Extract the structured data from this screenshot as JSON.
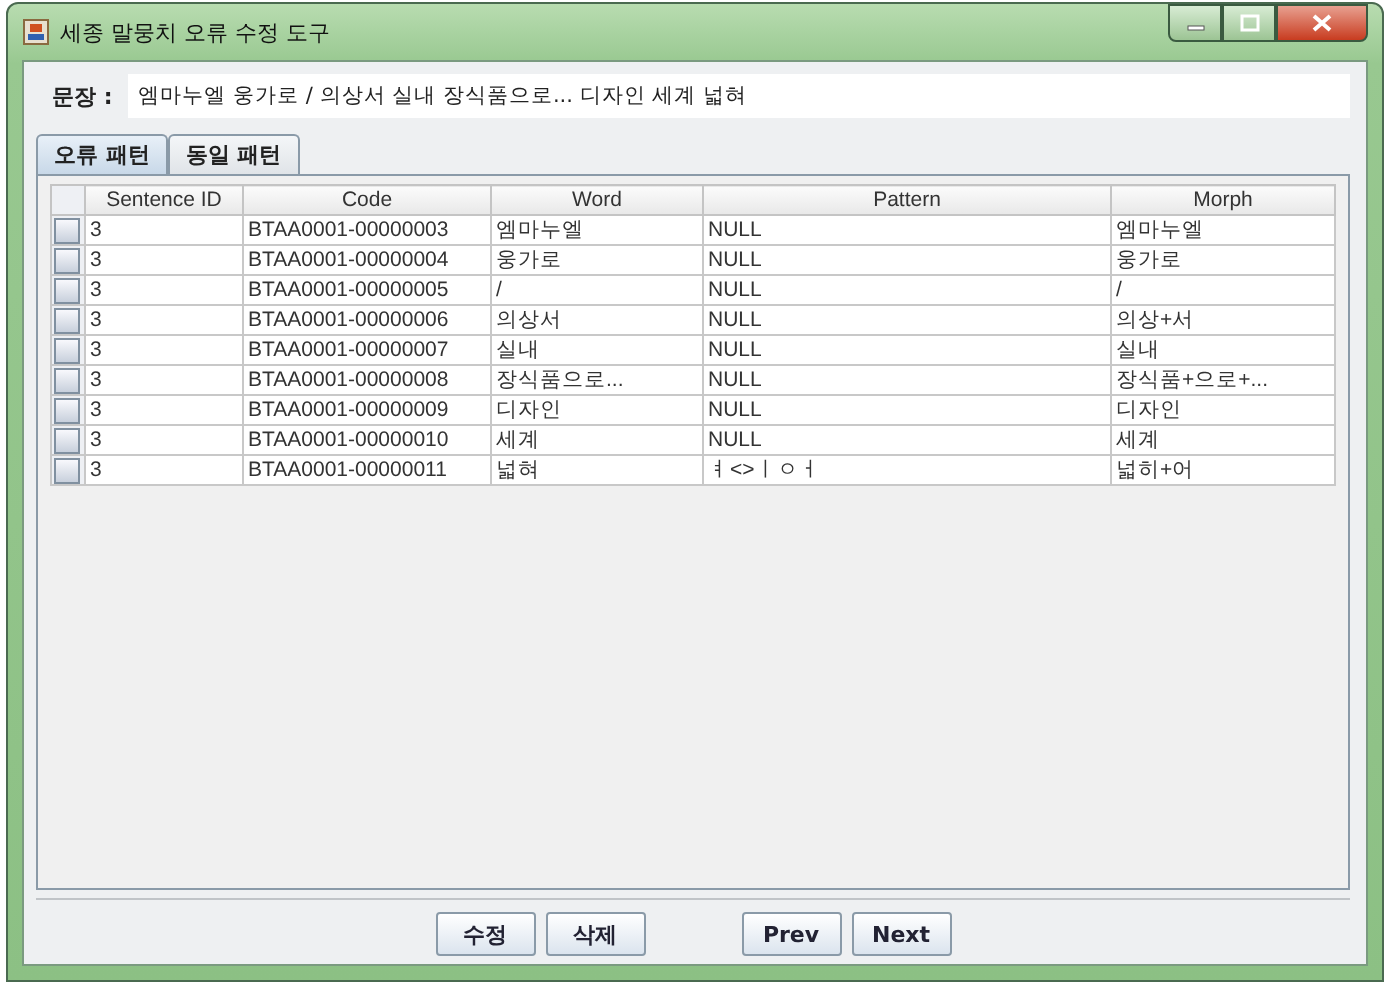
{
  "window": {
    "title": "세종 말뭉치 오류 수정 도구"
  },
  "sentence": {
    "label": "문장 :",
    "value": "엠마누엘 웅가로 / 의상서 실내 장식품으로... 디자인 세계 넓혀"
  },
  "tabs": [
    {
      "label": "오류 패턴",
      "selected": true
    },
    {
      "label": "동일 패턴",
      "selected": false
    }
  ],
  "table": {
    "columns": [
      "Sentence ID",
      "Code",
      "Word",
      "Pattern",
      "Morph"
    ],
    "rows": [
      {
        "checked": false,
        "cells": [
          "3",
          "BTAA0001-00000003",
          "엠마누엘",
          "NULL",
          "엠마누엘"
        ]
      },
      {
        "checked": false,
        "cells": [
          "3",
          "BTAA0001-00000004",
          "웅가로",
          "NULL",
          "웅가로"
        ]
      },
      {
        "checked": false,
        "cells": [
          "3",
          "BTAA0001-00000005",
          "/",
          "NULL",
          "/"
        ]
      },
      {
        "checked": false,
        "cells": [
          "3",
          "BTAA0001-00000006",
          "의상서",
          "NULL",
          "의상+서"
        ]
      },
      {
        "checked": false,
        "cells": [
          "3",
          "BTAA0001-00000007",
          "실내",
          "NULL",
          "실내"
        ]
      },
      {
        "checked": false,
        "cells": [
          "3",
          "BTAA0001-00000008",
          "장식품으로...",
          "NULL",
          "장식품+으로+..."
        ]
      },
      {
        "checked": false,
        "cells": [
          "3",
          "BTAA0001-00000009",
          "디자인",
          "NULL",
          "디자인"
        ]
      },
      {
        "checked": false,
        "cells": [
          "3",
          "BTAA0001-00000010",
          "세계",
          "NULL",
          "세계"
        ]
      },
      {
        "checked": false,
        "cells": [
          "3",
          "BTAA0001-00000011",
          "넓혀",
          "ㅕ<>ㅣㅇㅓ",
          "넓히+어"
        ]
      }
    ]
  },
  "button_groups": [
    [
      "수정",
      "삭제"
    ],
    [
      "Prev",
      "Next"
    ]
  ]
}
